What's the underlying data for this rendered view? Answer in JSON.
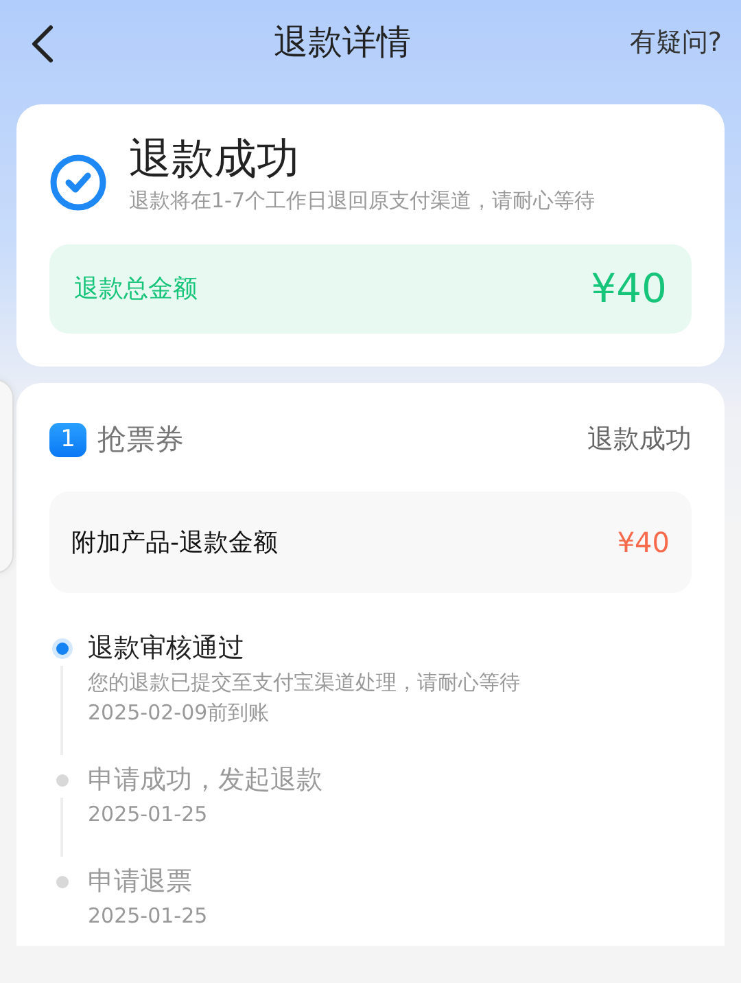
{
  "header": {
    "title": "退款详情",
    "help": "有疑问?"
  },
  "status": {
    "title": "退款成功",
    "note": "退款将在1-7个工作日退回原支付渠道，请耐心等待",
    "total_label": "退款总金额",
    "total_amount": "¥40"
  },
  "order": {
    "index": "1",
    "name": "抢票券",
    "state": "退款成功",
    "line_label": "附加产品-退款金额",
    "line_amount": "¥40",
    "timeline": [
      {
        "title": "退款审核通过",
        "lines": [
          "您的退款已提交至支付宝渠道处理，请耐心等待",
          "2025-02-09前到账"
        ],
        "active": true
      },
      {
        "title": "申请成功，发起退款",
        "lines": [
          "2025-01-25"
        ],
        "active": false
      },
      {
        "title": "申请退票",
        "lines": [
          "2025-01-25"
        ],
        "active": false
      }
    ]
  }
}
